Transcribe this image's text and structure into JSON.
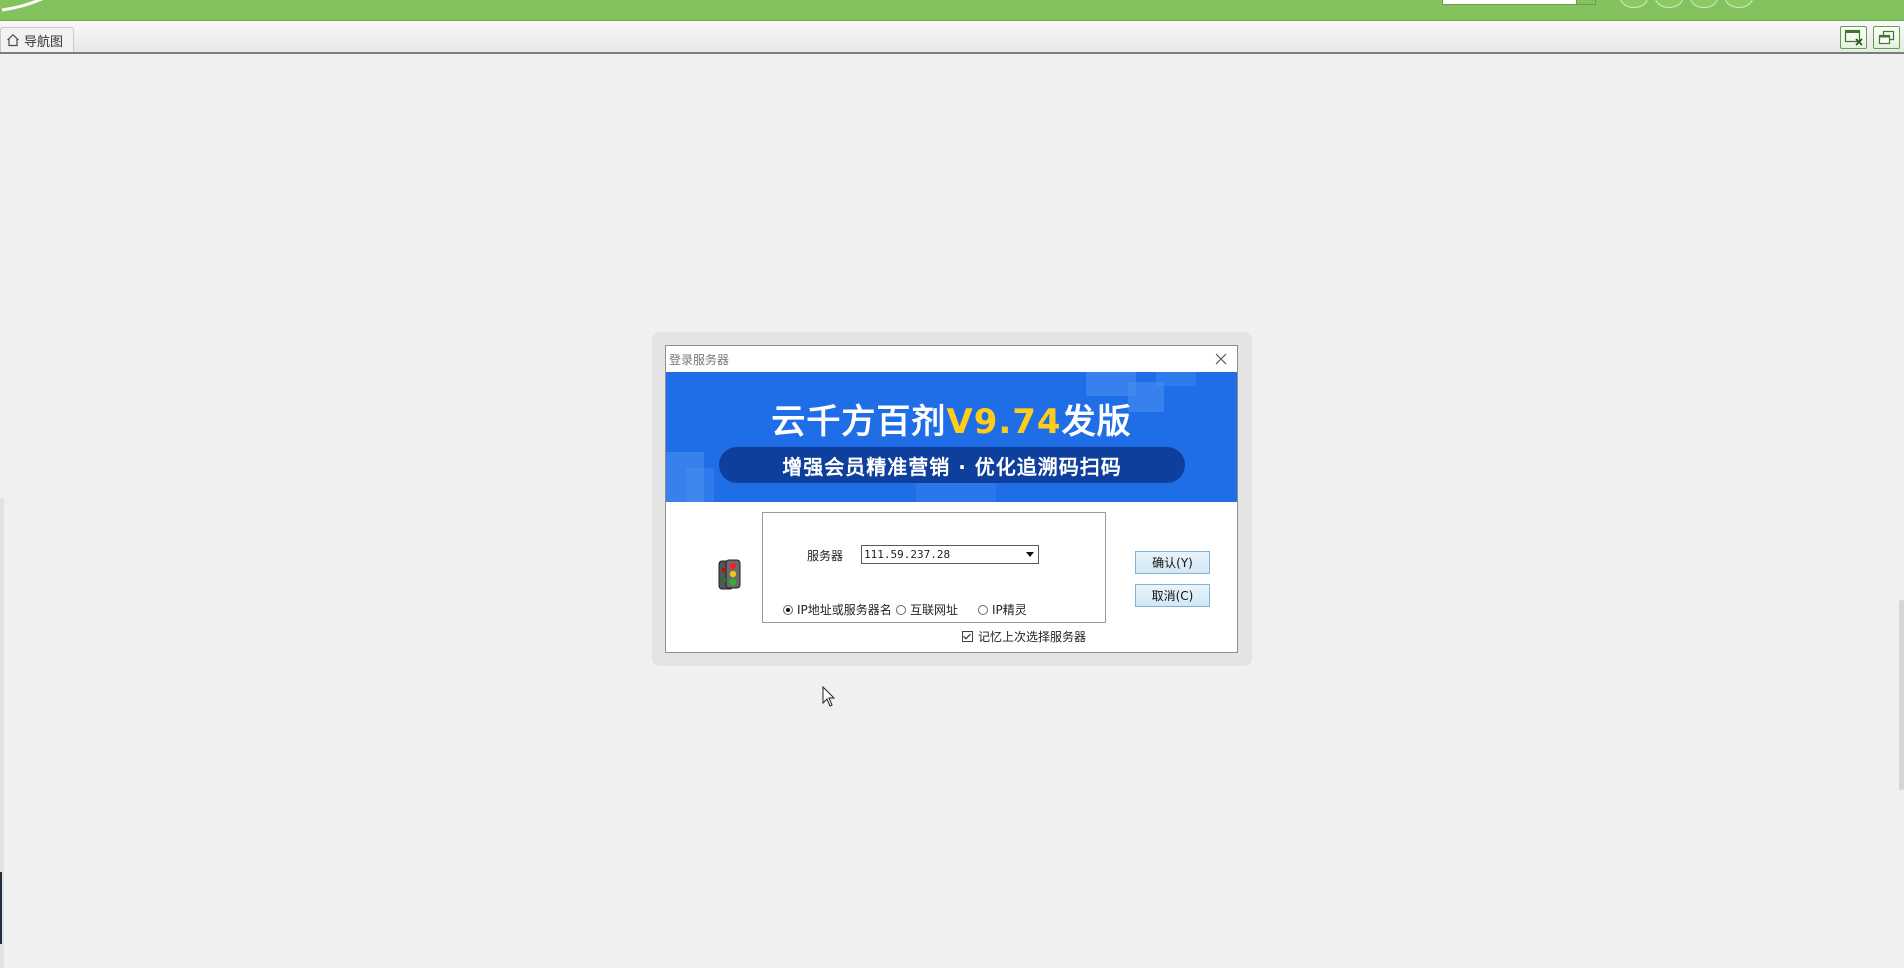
{
  "tabs": {
    "nav_tab_label": "导航图"
  },
  "dialog": {
    "title": "登录服务器",
    "banner": {
      "title_prefix": "云千方百剂",
      "title_version": "V9.74",
      "title_suffix": "发版",
      "subtitle": "增强会员精准营销 · 优化追溯码扫码"
    },
    "server_label": "服务器",
    "server_value": "111.59.237.28",
    "radios": [
      {
        "label": "IP地址或服务器名",
        "selected": true
      },
      {
        "label": "互联网址",
        "selected": false
      },
      {
        "label": "IP精灵",
        "selected": false
      }
    ],
    "remember_label": "记忆上次选择服务器",
    "remember_checked": true,
    "confirm_label": "确认(Y)",
    "cancel_label": "取消(C)"
  },
  "colors": {
    "topbar": "#84c25d",
    "banner": "#1f6ee8",
    "banner_highlight": "#ffcc1a",
    "banner_pill": "#0f3f9c"
  }
}
